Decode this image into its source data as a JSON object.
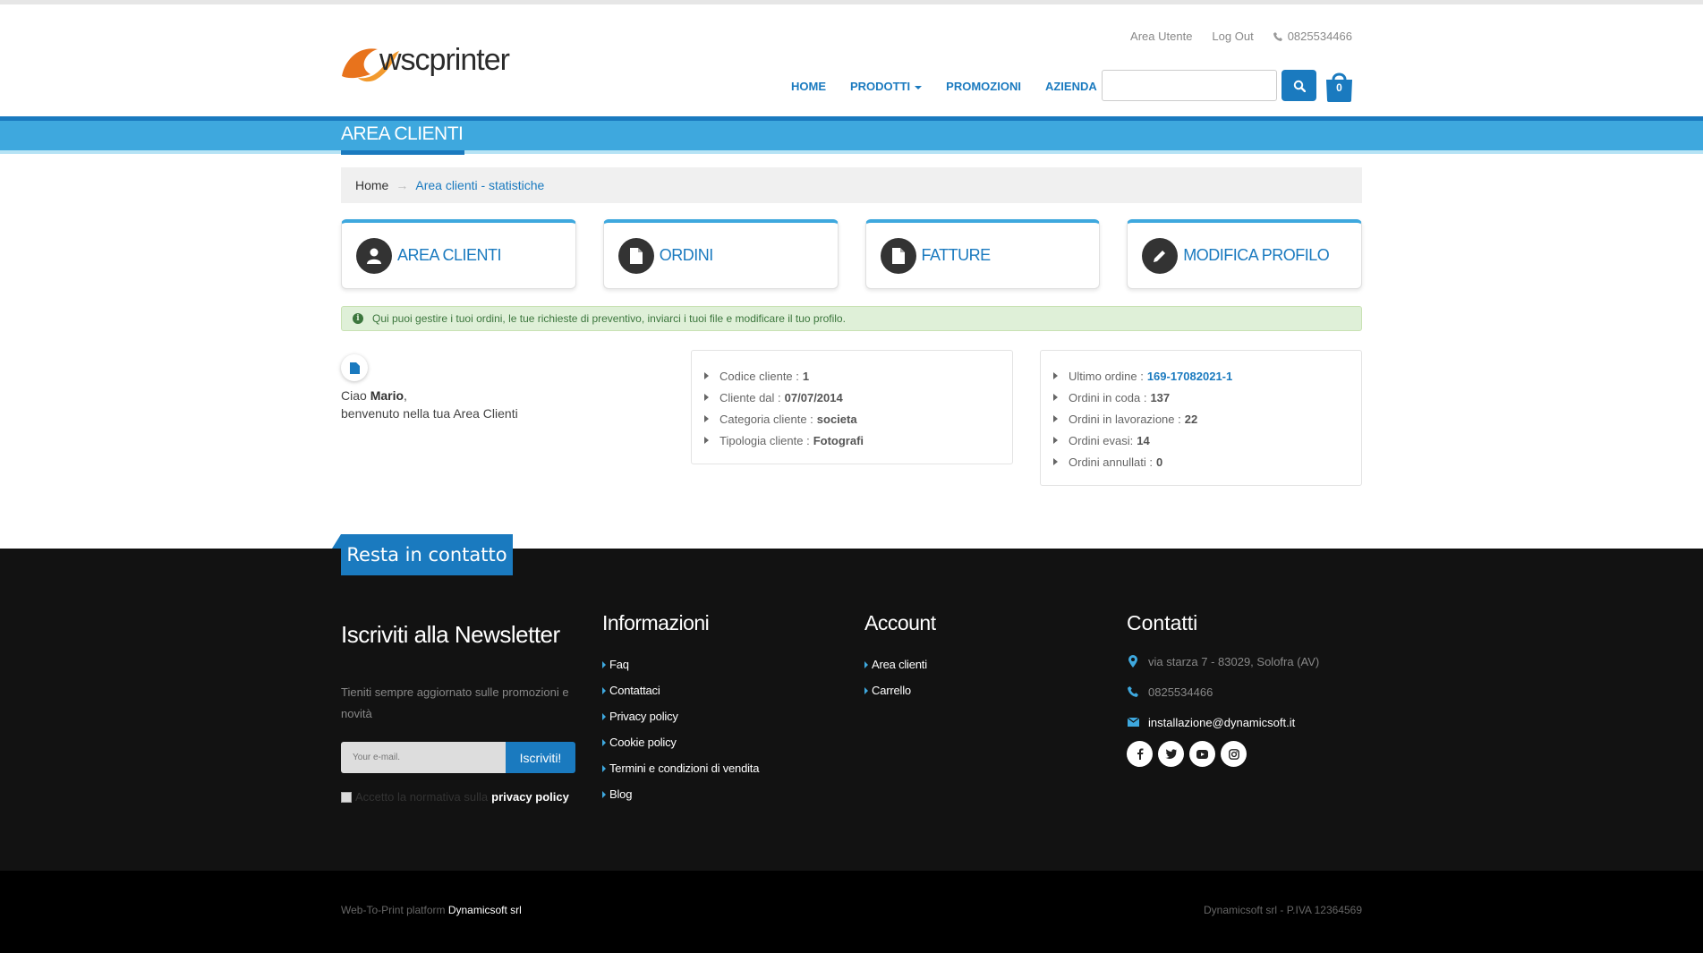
{
  "brand": {
    "logo_text": "wscprinter",
    "accent": "#1a7abf",
    "band": "#3ea8de"
  },
  "utility": {
    "user_area": "Area Utente",
    "logout": "Log Out",
    "phone": "0825534466"
  },
  "nav": {
    "home": "HOME",
    "products": "PRODOTTI",
    "promotions": "PROMOZIONI",
    "company": "AZIENDA"
  },
  "search": {
    "placeholder": ""
  },
  "cart": {
    "count": "0"
  },
  "page": {
    "title": "AREA CLIENTI"
  },
  "breadcrumb": {
    "home": "Home",
    "sep": "→",
    "current": "Area clienti - statistiche"
  },
  "tiles": [
    {
      "label": "AREA CLIENTI",
      "icon": "user-icon"
    },
    {
      "label": "ORDINI",
      "icon": "document-icon"
    },
    {
      "label": "FATTURE",
      "icon": "document-icon"
    },
    {
      "label": "MODIFICA PROFILO",
      "icon": "pencil-icon"
    }
  ],
  "alert": {
    "text": "Qui puoi gestire i tuoi ordini, le tue richieste di preventivo, inviarci i tuoi file e modificare il tuo profilo."
  },
  "welcome": {
    "hello": "Ciao ",
    "name": "Mario",
    "comma": ",",
    "line2": "benvenuto nella tua Area Clienti"
  },
  "customer": [
    {
      "label": "Codice cliente :",
      "value": "1"
    },
    {
      "label": "Cliente dal :",
      "value": "07/07/2014"
    },
    {
      "label": "Categoria cliente :",
      "value": "societa"
    },
    {
      "label": "Tipologia cliente :",
      "value": "Fotografi"
    }
  ],
  "orders": [
    {
      "label": "Ultimo ordine :",
      "value": "169-17082021-1"
    },
    {
      "label": "Ordini in coda :",
      "value": "137"
    },
    {
      "label": "Ordini in lavorazione :",
      "value": "22"
    },
    {
      "label": "Ordini evasi:",
      "value": "14"
    },
    {
      "label": "Ordini annullati :",
      "value": "0"
    }
  ],
  "footer": {
    "tab": "Resta in contatto",
    "newsletter": {
      "title": "Iscriviti alla Newsletter",
      "text": "Tieniti sempre aggiornato sulle promozioni e novità",
      "placeholder": "Your e-mail.",
      "button": "Iscriviti!",
      "privacy_prefix": "Accetto la normativa sulla",
      "privacy_link": "privacy policy"
    },
    "info": {
      "title": "Informazioni",
      "links": [
        "Faq",
        "Contattaci",
        "Privacy policy",
        "Cookie policy",
        "Termini e condizioni di vendita",
        "Blog"
      ]
    },
    "account": {
      "title": "Account",
      "links": [
        "Area clienti",
        "Carrello"
      ]
    },
    "contacts": {
      "title": "Contatti",
      "address": "via starza 7 - 83029, Solofra (AV)",
      "phone": "0825534466",
      "email": "installazione@dynamicsoft.it",
      "socials": [
        "facebook-icon",
        "twitter-icon",
        "youtube-icon",
        "instagram-icon"
      ]
    },
    "copyright_prefix": "Web-To-Print platform",
    "copyright_company": "Dynamicsoft srl",
    "vat": "Dynamicsoft srl - P.IVA 12364569"
  }
}
